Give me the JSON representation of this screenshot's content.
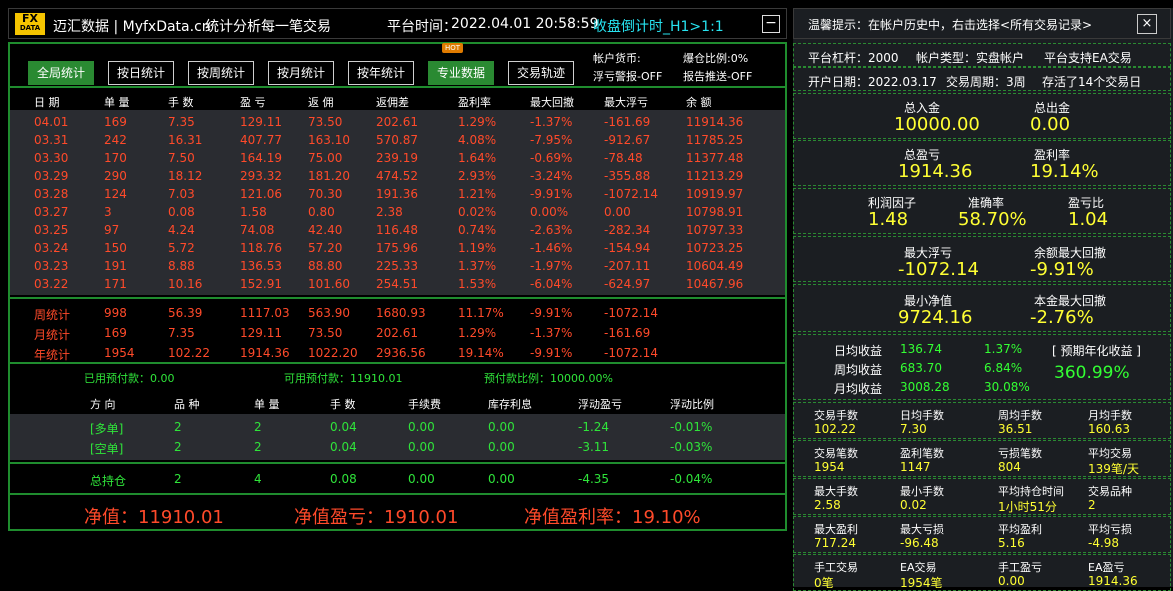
{
  "title": {
    "logo_top": "FX",
    "logo_bottom": "DATA",
    "brand": "迈汇数据 | MyfxData.cn",
    "slogan": "统计分析每一笔交易",
    "platform_time_label": "平台时间：",
    "platform_time": "2022.04.01 20:58:59",
    "countdown": "收盘倒计时_H1>1:1",
    "minimize": "−"
  },
  "buttons": [
    {
      "label": "全局统计",
      "active": true
    },
    {
      "label": "按日统计",
      "active": false
    },
    {
      "label": "按周统计",
      "active": false
    },
    {
      "label": "按月统计",
      "active": false
    },
    {
      "label": "按年统计",
      "active": false
    },
    {
      "label": "专业数据",
      "active": true
    },
    {
      "label": "交易轨迹",
      "active": false
    }
  ],
  "hot_badge": "HOT",
  "account_info": {
    "currency": "帐户货币:",
    "float_warn": "浮亏警报-OFF",
    "position_ratio": "爆仓比例:0%",
    "report_push": "报告推送-OFF"
  },
  "table_headers": [
    "日 期",
    "单 量",
    "手 数",
    "盈 亏",
    "返 佣",
    "返佣差",
    "盈利率",
    "最大回撤",
    "最大浮亏",
    "余 额"
  ],
  "daily_rows": [
    [
      "04.01",
      "169",
      "7.35",
      "129.11",
      "73.50",
      "202.61",
      "1.29%",
      "-1.37%",
      "-161.69",
      "11914.36"
    ],
    [
      "03.31",
      "242",
      "16.31",
      "407.77",
      "163.10",
      "570.87",
      "4.08%",
      "-7.95%",
      "-912.67",
      "11785.25"
    ],
    [
      "03.30",
      "170",
      "7.50",
      "164.19",
      "75.00",
      "239.19",
      "1.64%",
      "-0.69%",
      "-78.48",
      "11377.48"
    ],
    [
      "03.29",
      "290",
      "18.12",
      "293.32",
      "181.20",
      "474.52",
      "2.93%",
      "-3.24%",
      "-355.88",
      "11213.29"
    ],
    [
      "03.28",
      "124",
      "7.03",
      "121.06",
      "70.30",
      "191.36",
      "1.21%",
      "-9.91%",
      "-1072.14",
      "10919.97"
    ],
    [
      "03.27",
      "3",
      "0.08",
      "1.58",
      "0.80",
      "2.38",
      "0.02%",
      "0.00%",
      "0.00",
      "10798.91"
    ],
    [
      "03.25",
      "97",
      "4.24",
      "74.08",
      "42.40",
      "116.48",
      "0.74%",
      "-2.63%",
      "-282.34",
      "10797.33"
    ],
    [
      "03.24",
      "150",
      "5.72",
      "118.76",
      "57.20",
      "175.96",
      "1.19%",
      "-1.46%",
      "-154.94",
      "10723.25"
    ],
    [
      "03.23",
      "191",
      "8.88",
      "136.53",
      "88.80",
      "225.33",
      "1.37%",
      "-1.97%",
      "-207.11",
      "10604.49"
    ],
    [
      "03.22",
      "171",
      "10.16",
      "152.91",
      "101.60",
      "254.51",
      "1.53%",
      "-6.04%",
      "-624.97",
      "10467.96"
    ]
  ],
  "summary_rows": [
    [
      "周统计",
      "998",
      "56.39",
      "1117.03",
      "563.90",
      "1680.93",
      "11.17%",
      "-9.91%",
      "-1072.14"
    ],
    [
      "月统计",
      "169",
      "7.35",
      "129.11",
      "73.50",
      "202.61",
      "1.29%",
      "-1.37%",
      "-161.69"
    ],
    [
      "年统计",
      "1954",
      "102.22",
      "1914.36",
      "1022.20",
      "2936.56",
      "19.14%",
      "-9.91%",
      "-1072.14"
    ]
  ],
  "margin": {
    "used": "已用预付款：0.00",
    "available": "可用预付款：11910.01",
    "ratio": "预付款比例：10000.00%"
  },
  "position_headers": [
    "方 向",
    "品 种",
    "单 量",
    "手 数",
    "手续费",
    "库存利息",
    "浮动盈亏",
    "浮动比例"
  ],
  "position_rows": [
    [
      "[多单]",
      "2",
      "2",
      "0.04",
      "0.00",
      "0.00",
      "-1.24",
      "-0.01%"
    ],
    [
      "[空单]",
      "2",
      "2",
      "0.04",
      "0.00",
      "0.00",
      "-3.11",
      "-0.03%"
    ]
  ],
  "total_row": [
    "总持仓",
    "2",
    "4",
    "0.08",
    "0.00",
    "0.00",
    "-4.35",
    "-0.04%"
  ],
  "equity": {
    "net_value": "净值：11910.01",
    "net_profit": "净值盈亏：1910.01",
    "net_rate": "净值盈利率：19.10%"
  },
  "right": {
    "tip": "温馨提示：在帐户历史中，右击选择<所有交易记录>",
    "close": "×",
    "leverage": "平台杠杆：2000",
    "account_type": "帐户类型：实盘帐户",
    "ea_support": "平台支持EA交易",
    "open_date": "开户日期：2022.03.17",
    "trade_period": "交易周期：3周",
    "stored": "存活了14个交易日",
    "deposit_label": "总入金",
    "deposit": "10000.00",
    "withdraw_label": "总出金",
    "withdraw": "0.00",
    "profit_label": "总盈亏",
    "profit": "1914.36",
    "profit_rate_label": "盈利率",
    "profit_rate": "19.14%",
    "pf_label": "利润因子",
    "pf": "1.48",
    "accuracy_label": "准确率",
    "accuracy": "58.70%",
    "pl_ratio_label": "盈亏比",
    "pl_ratio": "1.04",
    "max_float_label": "最大浮亏",
    "max_float": "-1072.14",
    "max_dd_label": "余额最大回撤",
    "max_dd": "-9.91%",
    "min_equity_label": "最小净值",
    "min_equity": "9724.16",
    "principal_dd_label": "本金最大回撤",
    "principal_dd": "-2.76%",
    "daily_label": "日均收益",
    "daily": "136.74",
    "daily_pct": "1.37%",
    "weekly_label": "周均收益",
    "weekly": "683.70",
    "weekly_pct": "6.84%",
    "monthly_label": "月均收益",
    "monthly": "3008.28",
    "monthly_pct": "30.08%",
    "annual_label": "[ 预期年化收益 ]",
    "annual": "360.99%",
    "grid": [
      [
        "交易手数",
        "102.22"
      ],
      [
        "日均手数",
        "7.30"
      ],
      [
        "周均手数",
        "36.51"
      ],
      [
        "月均手数",
        "160.63"
      ],
      [
        "交易笔数",
        "1954"
      ],
      [
        "盈利笔数",
        "1147"
      ],
      [
        "亏损笔数",
        "804"
      ],
      [
        "平均交易",
        "139笔/天"
      ],
      [
        "最大手数",
        "2.58"
      ],
      [
        "最小手数",
        "0.02"
      ],
      [
        "平均持仓时间",
        "1小时51分"
      ],
      [
        "交易品种",
        "2"
      ],
      [
        "最大盈利",
        "717.24"
      ],
      [
        "最大亏损",
        "-96.48"
      ],
      [
        "平均盈利",
        "5.16"
      ],
      [
        "平均亏损",
        "-4.98"
      ],
      [
        "手工交易",
        "0笔"
      ],
      [
        "EA交易",
        "1954笔"
      ],
      [
        "手工盈亏",
        "0.00"
      ],
      [
        "EA盈亏",
        "1914.36"
      ]
    ]
  }
}
